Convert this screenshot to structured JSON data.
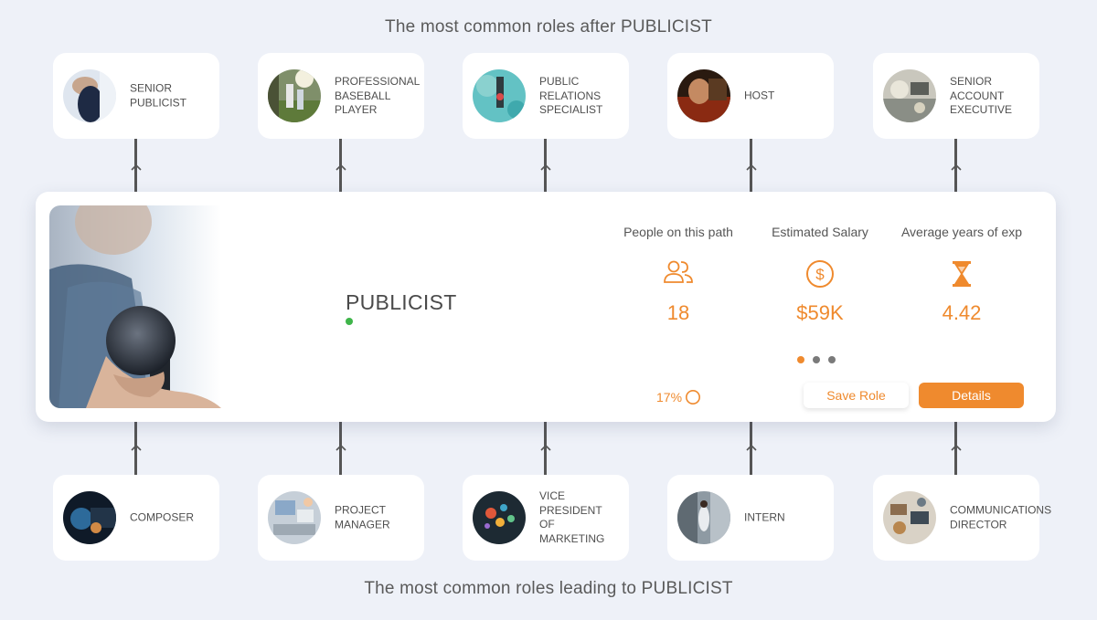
{
  "titles": {
    "after": "The most common roles after PUBLICIST",
    "leading": "The most common roles leading to PUBLICIST"
  },
  "roles_after": [
    {
      "label": "SENIOR PUBLICIST",
      "icon": "senior-publicist-photo"
    },
    {
      "label": "PROFESSIONAL BASEBALL PLAYER",
      "icon": "baseball-player-photo"
    },
    {
      "label": "PUBLIC RELATIONS SPECIALIST",
      "icon": "pr-specialist-photo"
    },
    {
      "label": "HOST",
      "icon": "host-photo"
    },
    {
      "label": "SENIOR ACCOUNT EXECUTIVE",
      "icon": "account-executive-photo"
    }
  ],
  "roles_leading": [
    {
      "label": "COMPOSER",
      "icon": "composer-photo"
    },
    {
      "label": "PROJECT MANAGER",
      "icon": "project-manager-photo"
    },
    {
      "label": "VICE PRESIDENT OF MARKETING",
      "icon": "vp-marketing-photo"
    },
    {
      "label": "INTERN",
      "icon": "intern-photo"
    },
    {
      "label": "COMMUNICATIONS DIRECTOR",
      "icon": "communications-director-photo"
    }
  ],
  "main": {
    "title": "PUBLICIST",
    "status_color": "#3fb54a",
    "stats": [
      {
        "label": "People on this path",
        "value": "18",
        "icon": "people-icon"
      },
      {
        "label": "Estimated Salary",
        "value": "$59K",
        "icon": "dollar-icon"
      },
      {
        "label": "Average years of exp",
        "value": "4.42",
        "icon": "hourglass-icon"
      }
    ],
    "pager": {
      "pages": 3,
      "active": 1
    },
    "progress": "17%",
    "save_label": "Save Role",
    "details_label": "Details"
  },
  "colors": {
    "accent": "#ef8a2e",
    "background": "#eef1f8",
    "connector": "#555555"
  }
}
